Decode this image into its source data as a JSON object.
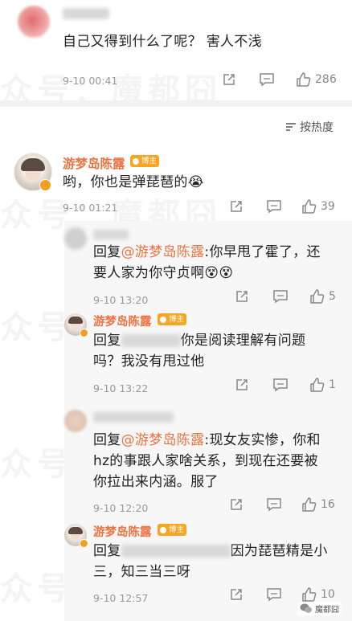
{
  "comment1": {
    "text": "自己又得到什么了呢？ 害人不浅",
    "time": "9-10 00:41",
    "likes": "286"
  },
  "sort_label": "按热度",
  "comment2": {
    "author": "游梦岛陈露",
    "badge": "博主",
    "text": "哟，你也是弹琵琶的😭",
    "time": "9-10 01:21",
    "likes": "39"
  },
  "replies": [
    {
      "prefix": "回复",
      "mention": "@游梦岛陈露",
      "line1": ":你早甩了霍了，还",
      "line2": "要人家为你守贞啊😵😵",
      "time": "9-10 13:20",
      "likes": "5"
    },
    {
      "author": "游梦岛陈露",
      "badge": "博主",
      "prefix": "回复",
      "line1": "你是阅读理解有问题",
      "line2": "吗？我没有甩过他",
      "time": "9-10 13:22",
      "likes": "1"
    },
    {
      "prefix": "回复",
      "mention": "@游梦岛陈露",
      "line1": ":现女友实惨，你和",
      "line2": "hz的事跟人家啥关系，到现在还要被",
      "line3": "你拉出来内涵。服了",
      "time": "9-10 12:20",
      "likes": "16"
    },
    {
      "author": "游梦岛陈露",
      "badge": "博主",
      "prefix": "回复",
      "line1": "因为琵琶精是小",
      "line2": "三，知三当三呀",
      "time": "9-10 12:57",
      "likes": "10"
    }
  ],
  "watermark": {
    "text1": "众号：魔都囧",
    "logo_text": "魔都囧"
  },
  "colors": {
    "accent": "#eb7340",
    "badge": "#f6a623",
    "muted": "#999999"
  }
}
